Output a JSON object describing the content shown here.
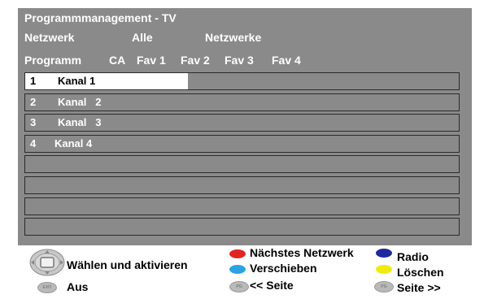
{
  "header": {
    "title": "Programmmanagement - TV",
    "network_label": "Netzwerk",
    "network_value": "Alle",
    "network_value2": "Netzwerke",
    "columns": [
      "Programm",
      "CA",
      "Fav 1",
      "Fav 2",
      "Fav 3",
      "Fav 4"
    ]
  },
  "channels": [
    {
      "num": "1",
      "name": "Kanal 1",
      "selected": true
    },
    {
      "num": "2",
      "name": "Kanal   2",
      "selected": false
    },
    {
      "num": "3",
      "name": "Kanal   3",
      "selected": false
    },
    {
      "num": "4",
      "name": "Kanal 4",
      "selected": false
    },
    {
      "num": "",
      "name": "",
      "selected": false
    },
    {
      "num": "",
      "name": "",
      "selected": false
    },
    {
      "num": "",
      "name": "",
      "selected": false
    },
    {
      "num": "",
      "name": "",
      "selected": false
    }
  ],
  "legend": {
    "select_activate": "Wählen und aktivieren",
    "exit": "Aus",
    "next_network": "Nächstes Netzwerk",
    "move": "Verschieben",
    "prev_page": "<< Seite",
    "radio": "Radio",
    "delete": "Löschen",
    "next_page": "Seite >>"
  },
  "colors": {
    "panel": "#8a8a8a",
    "red": "#e02424",
    "cyan": "#2aa3e0",
    "blue": "#1e2a9c",
    "yellow": "#f0ea10",
    "grey": "#b9b9b9"
  }
}
